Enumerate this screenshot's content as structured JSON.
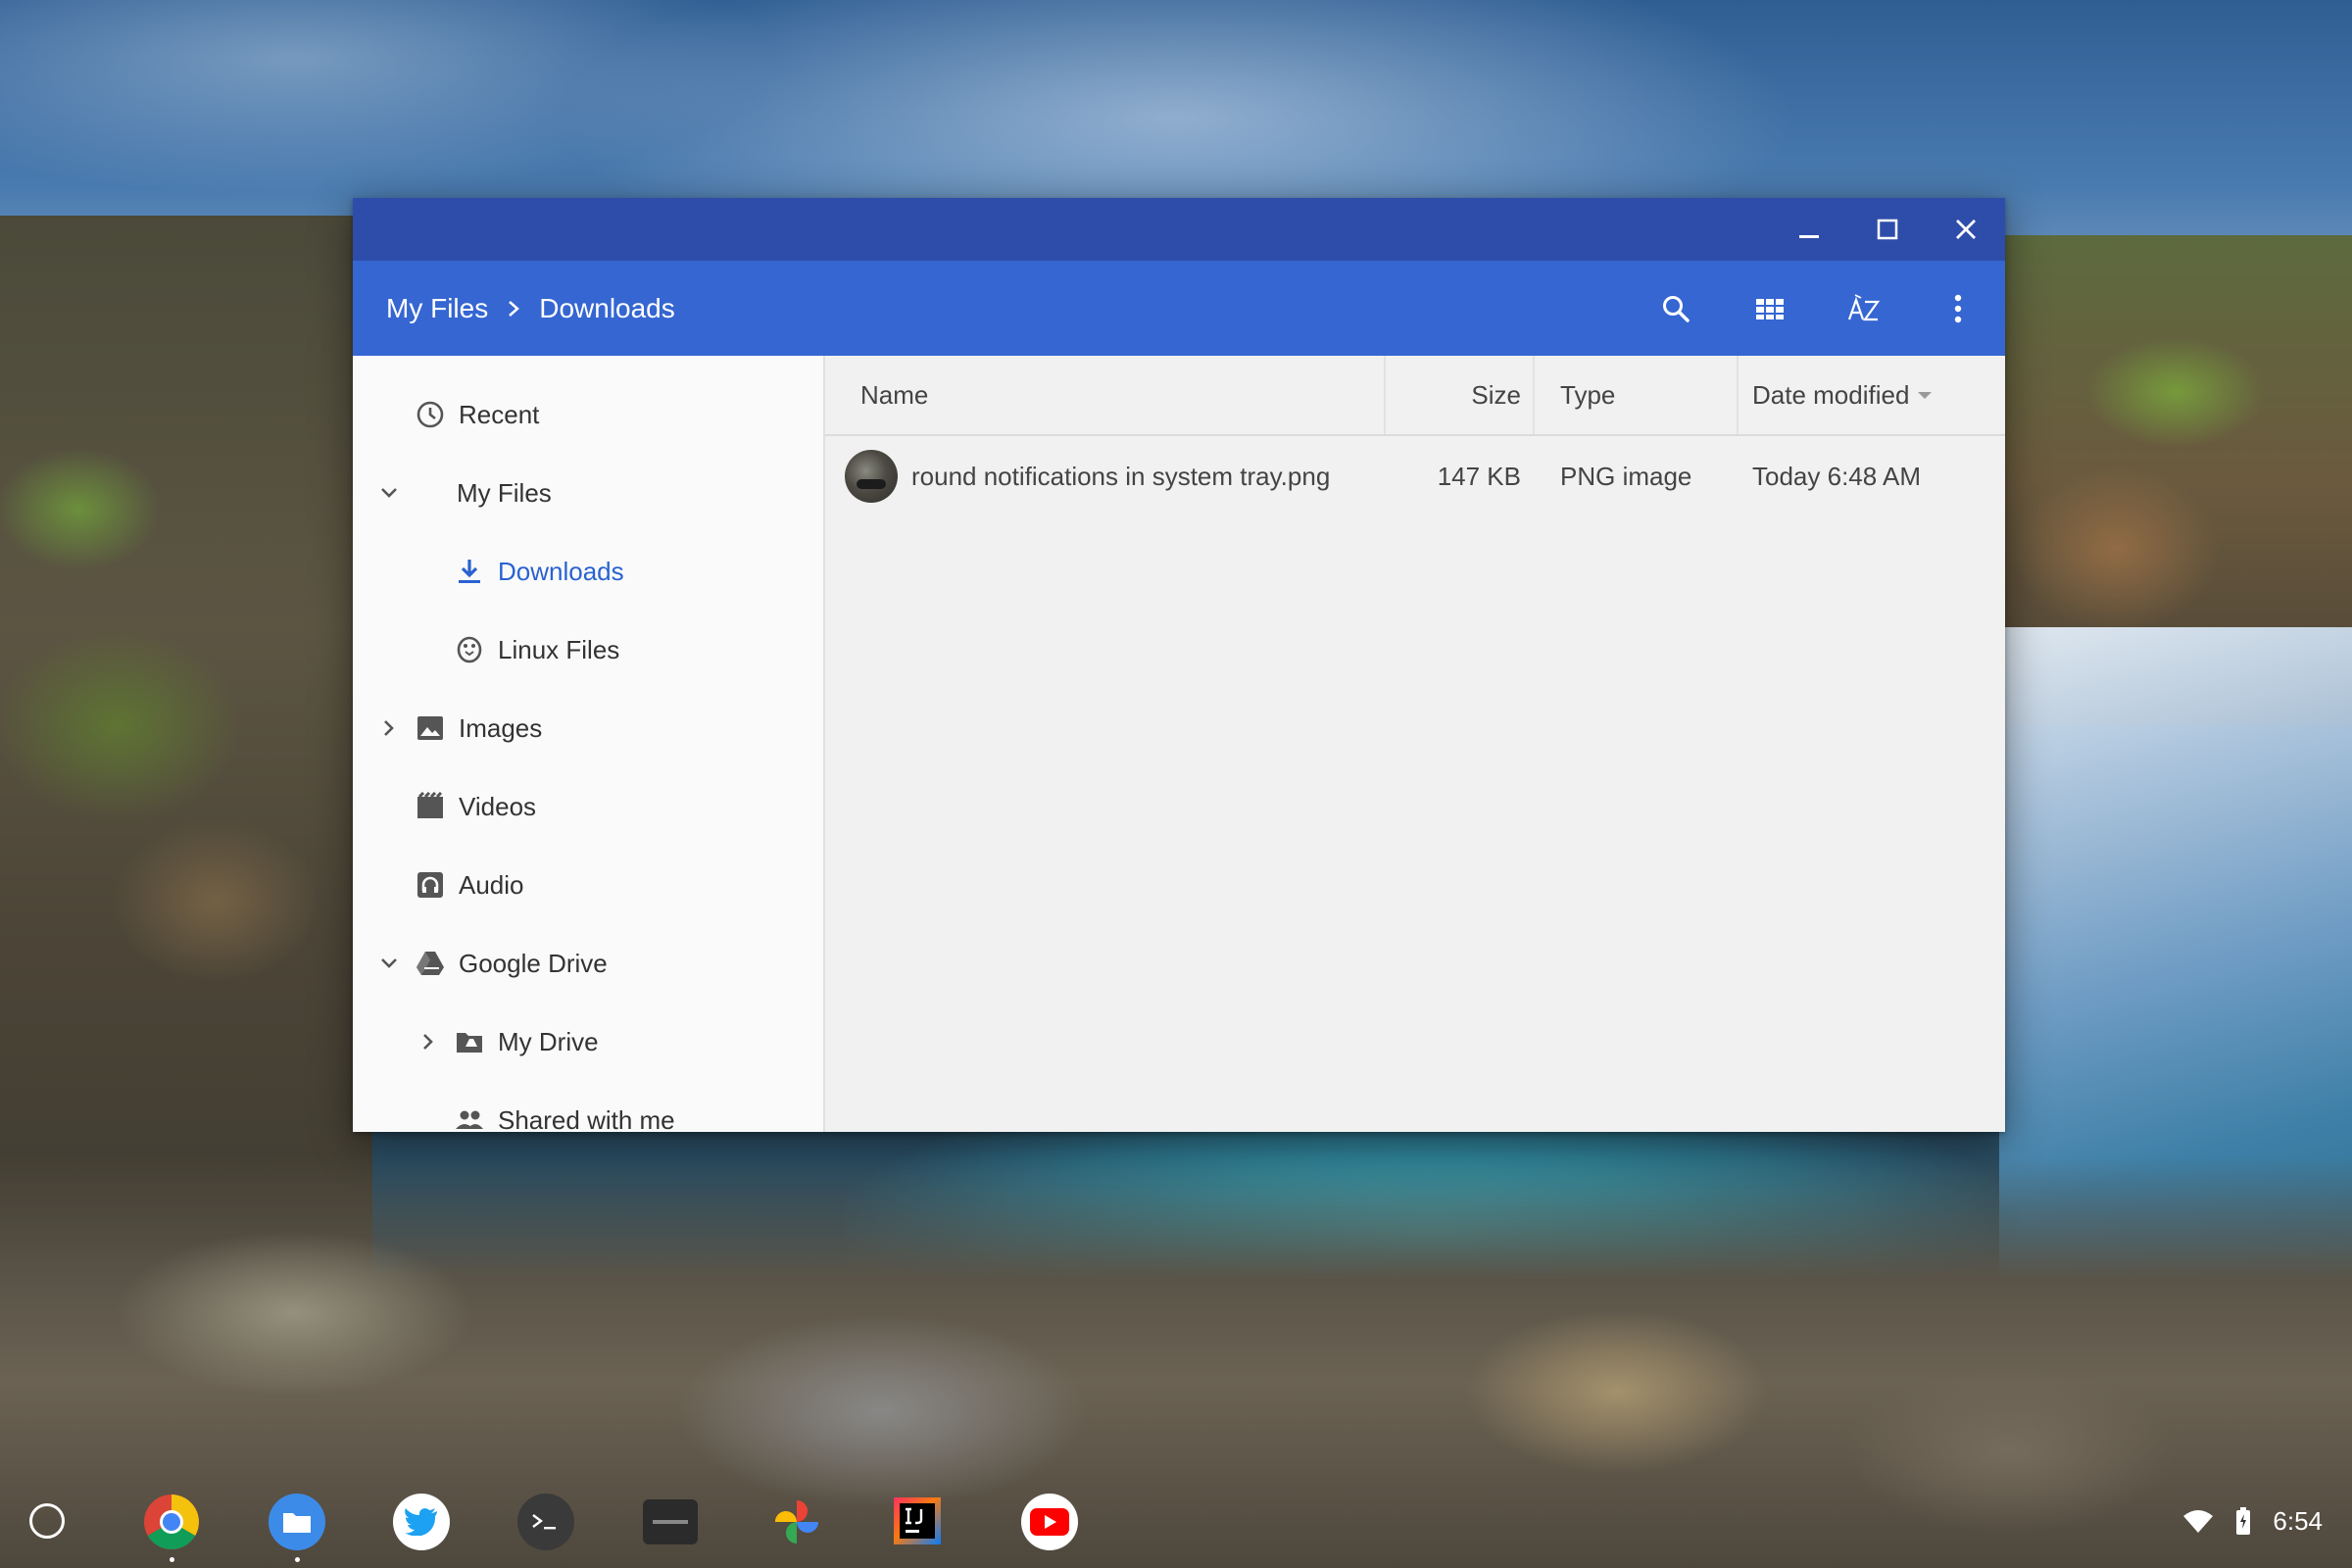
{
  "window": {
    "controls": {
      "minimize": "minimize-icon",
      "maximize": "maximize-icon",
      "close": "close-icon"
    }
  },
  "breadcrumb": [
    "My Files",
    "Downloads"
  ],
  "toolbar": {
    "search_icon": "search-icon",
    "view_icon": "grid-view-icon",
    "sort_icon": "sort-az-icon",
    "more_icon": "more-vert-icon"
  },
  "sidebar": {
    "items": [
      {
        "label": "Recent",
        "icon": "clock-icon"
      },
      {
        "label": "My Files",
        "icon": "none",
        "expand": "expanded"
      },
      {
        "label": "Downloads",
        "icon": "download-icon",
        "selected": true
      },
      {
        "label": "Linux Files",
        "icon": "penguin-icon"
      },
      {
        "label": "Images",
        "icon": "image-icon",
        "expand": "collapsed"
      },
      {
        "label": "Videos",
        "icon": "video-icon"
      },
      {
        "label": "Audio",
        "icon": "headphones-icon"
      },
      {
        "label": "Google Drive",
        "icon": "drive-icon",
        "expand": "expanded"
      },
      {
        "label": "My Drive",
        "icon": "drive-folder-icon",
        "expand": "collapsed"
      },
      {
        "label": "Shared with me",
        "icon": "people-icon"
      }
    ]
  },
  "filelist": {
    "columns": {
      "name": "Name",
      "size": "Size",
      "type": "Type",
      "date": "Date modified"
    },
    "sort": {
      "column": "Date modified",
      "direction": "descending"
    },
    "files": [
      {
        "name": "round notifications in system tray.png",
        "size": "147 KB",
        "type": "PNG image",
        "date": "Today 6:48 AM"
      }
    ]
  },
  "shelf": {
    "apps": [
      {
        "name": "Chrome",
        "icon": "chrome-icon",
        "running": true
      },
      {
        "name": "Files",
        "icon": "files-icon",
        "running": true
      },
      {
        "name": "Twitter",
        "icon": "twitter-icon",
        "running": false
      },
      {
        "name": "Terminal",
        "icon": "terminal-icon",
        "running": false
      },
      {
        "name": "Terminal Beta",
        "icon": "terminal-beta-icon",
        "running": false
      },
      {
        "name": "Photos",
        "icon": "photos-icon",
        "running": false
      },
      {
        "name": "IntelliJ IDEA",
        "icon": "intellij-icon",
        "running": false
      },
      {
        "name": "YouTube",
        "icon": "youtube-icon",
        "running": false
      }
    ],
    "tray": {
      "wifi_icon": "wifi-icon",
      "battery_icon": "battery-charging-icon",
      "time": "6:54"
    }
  },
  "colors": {
    "titlebar": "#2e4daa",
    "appbar": "#3566d2",
    "selected_text": "#2a62d0",
    "sidebar_bg": "#fafafa",
    "list_bg": "#f1f1f1"
  }
}
